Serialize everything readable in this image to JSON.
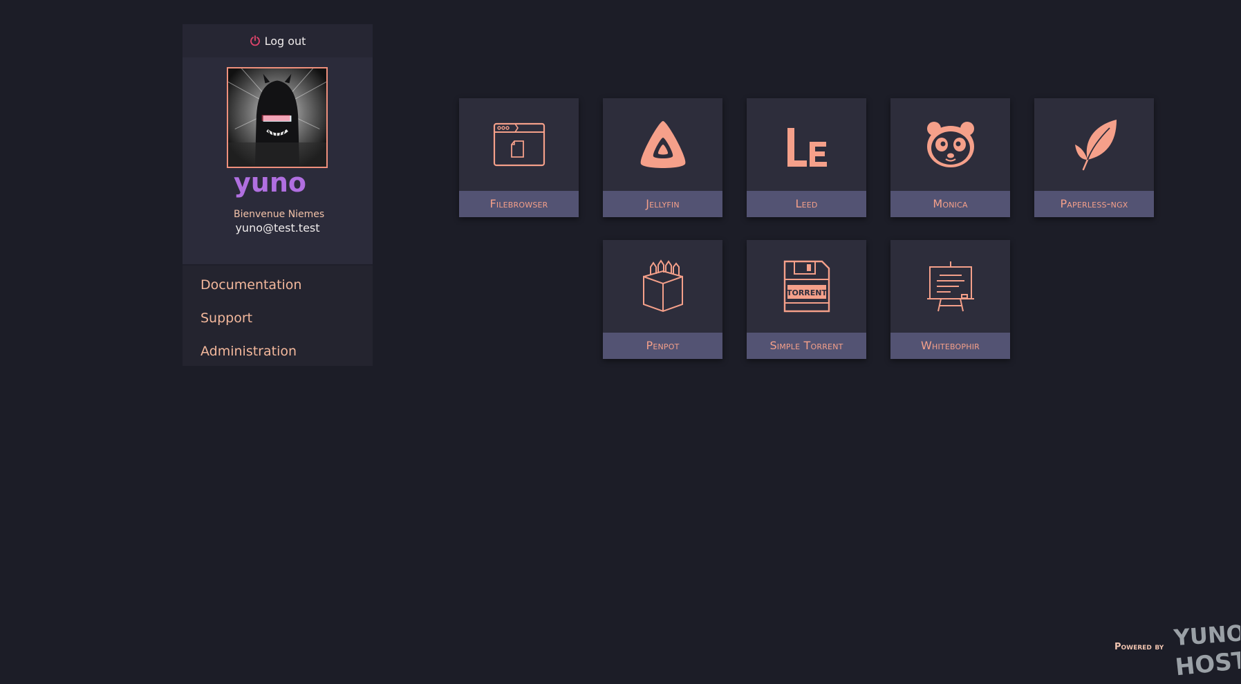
{
  "header": {
    "logout_label": "Log out"
  },
  "user": {
    "username": "yuno",
    "fullname": "Bienvenue Niemes",
    "email": "yuno@test.test"
  },
  "nav": {
    "items": [
      {
        "label": "Documentation"
      },
      {
        "label": "Support"
      },
      {
        "label": "Administration"
      }
    ]
  },
  "apps": [
    {
      "label": "Filebrowser",
      "icon": "browser-window-icon"
    },
    {
      "label": "Jellyfin",
      "icon": "jellyfin-triangle-icon"
    },
    {
      "label": "Leed",
      "icon": "leed-le-icon"
    },
    {
      "label": "Monica",
      "icon": "panda-icon"
    },
    {
      "label": "Paperless-ngx",
      "icon": "leaf-icon"
    },
    {
      "label": "Penpot",
      "icon": "pencil-cup-icon"
    },
    {
      "label": "Simple Torrent",
      "icon": "floppy-torrent-icon"
    },
    {
      "label": "Whitebophir",
      "icon": "whiteboard-easel-icon"
    }
  ],
  "footer": {
    "powered_by": "Powered by",
    "logo_text_top": "YUNO",
    "logo_text_bottom": "HOST"
  },
  "colors": {
    "background": "#1c1d27",
    "tile": "#2d2d3b",
    "tile_label": "#535373",
    "accent": "#f5a08a",
    "username": "#b06fe0"
  }
}
